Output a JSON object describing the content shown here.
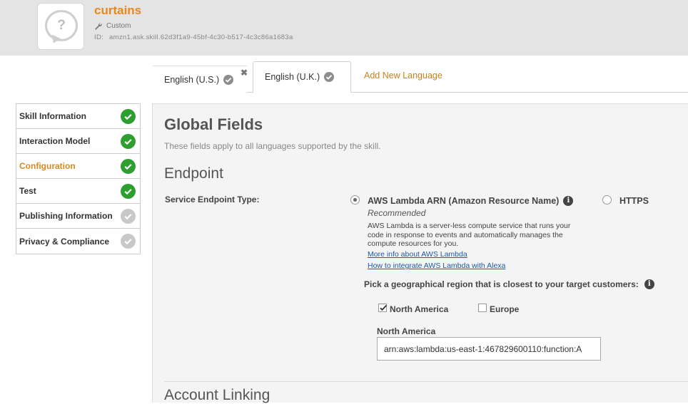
{
  "header": {
    "skill_name": "curtains",
    "skill_type": "Custom",
    "id_label": "ID:",
    "skill_id": "amzn1.ask.skill.62d3f1a9-45bf-4c30-b517-4c3c86a1683a",
    "icon": "question-bubble-icon"
  },
  "tabs": {
    "items": [
      {
        "label": "English (U.S.)",
        "active": false,
        "status_icon": "check-icon"
      },
      {
        "label": "English (U.K.)",
        "active": true,
        "status_icon": "check-icon"
      }
    ],
    "close_glyph": "✖",
    "add_label": "Add New Language"
  },
  "sidebar": {
    "items": [
      {
        "label": "Skill Information",
        "complete": true
      },
      {
        "label": "Interaction Model",
        "complete": true
      },
      {
        "label": "Configuration",
        "complete": true,
        "current": true
      },
      {
        "label": "Test",
        "complete": true
      },
      {
        "label": "Publishing Information",
        "complete": false
      },
      {
        "label": "Privacy & Compliance",
        "complete": false
      }
    ]
  },
  "main": {
    "title": "Global Fields",
    "subtitle": "These fields apply to all languages supported by the skill.",
    "endpoint": {
      "section_title": "Endpoint",
      "field_label": "Service Endpoint Type:",
      "option_lambda": "AWS Lambda ARN (Amazon Resource Name)",
      "option_https": "HTTPS",
      "selected": "lambda",
      "recommended": "Recommended",
      "description": "AWS Lambda is a server-less compute service that runs your code in response to events and automatically manages the compute resources for you.",
      "link_more": "More info about AWS Lambda",
      "link_integrate": "How to integrate AWS Lambda with Alexa",
      "region_prompt": "Pick a geographical region that is closest to your target customers:",
      "regions": [
        {
          "label": "North America",
          "checked": true
        },
        {
          "label": "Europe",
          "checked": false
        }
      ],
      "arn_label": "North America",
      "arn_value": "arn:aws:lambda:us-east-1:467829600110:function:A"
    },
    "next_section_title": "Account Linking"
  },
  "colors": {
    "accent_orange": "#e8881a",
    "complete_green": "#2e9e2e",
    "incomplete_gray": "#c8c8c8",
    "link_blue": "#1a5aa8"
  }
}
